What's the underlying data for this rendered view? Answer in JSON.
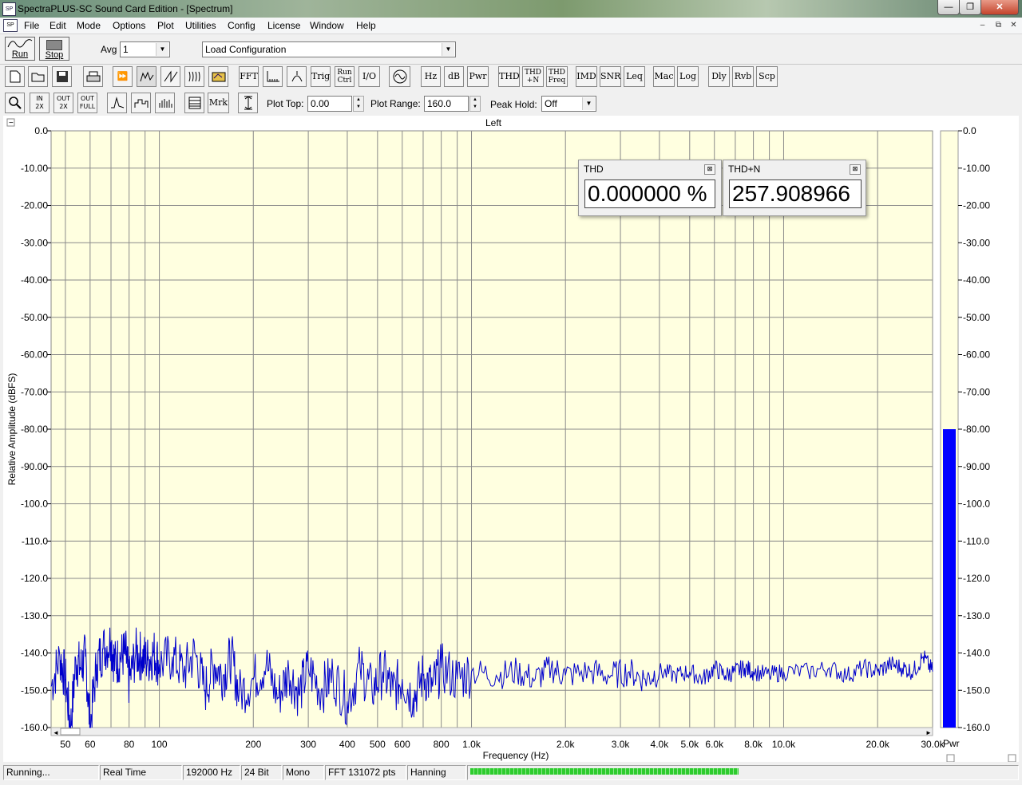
{
  "window": {
    "title": "SpectraPLUS-SC Sound Card Edition - [Spectrum]",
    "minimize": "—",
    "maximize": "❐",
    "close": "✕"
  },
  "menu": [
    "File",
    "Edit",
    "Mode",
    "Options",
    "Plot",
    "Utilities",
    "Config",
    "License",
    "Window",
    "Help"
  ],
  "mdi_controls": [
    "–",
    "⧉",
    "✕"
  ],
  "run_bar": {
    "run_label": "Run",
    "stop_label": "Stop",
    "avg_label": "Avg",
    "avg_value": "1",
    "config_value": "Load Configuration"
  },
  "toolbar1": {
    "fft": "FFT",
    "trig": "Trig",
    "run_ctrl_1": "Run",
    "run_ctrl_2": "Ctrl",
    "io": "I/O",
    "hz": "Hz",
    "db": "dB",
    "pwr": "Pwr",
    "thd": "THD",
    "thdn_1": "THD",
    "thdn_2": "+N",
    "thdf_1": "THD",
    "thdf_2": "Freq",
    "imd": "IMD",
    "snr": "SNR",
    "leq": "Leq",
    "mac": "Mac",
    "log": "Log",
    "dly": "Dly",
    "rvb": "Rvb",
    "scp": "Scp"
  },
  "toolbar2": {
    "zoom_in_1": "IN",
    "zoom_in_2": "2X",
    "zoom_out_1": "OUT",
    "zoom_out_2": "2X",
    "zoom_full_1": "OUT",
    "zoom_full_2": "FULL",
    "mrk": "Mrk",
    "plot_top_label": "Plot Top:",
    "plot_top_value": "0.00",
    "plot_range_label": "Plot Range:",
    "plot_range_value": "160.0",
    "peak_hold_label": "Peak Hold:",
    "peak_hold_value": "Off"
  },
  "chart_data": {
    "type": "line",
    "title": "Left",
    "xlabel": "Frequency (Hz)",
    "ylabel": "Relative Amplitude (dBFS)",
    "x_scale": "log",
    "xlim": [
      45,
      30000
    ],
    "ylim": [
      -160,
      0
    ],
    "x_ticks": [
      {
        "v": 50,
        "l": "50"
      },
      {
        "v": 60,
        "l": "60"
      },
      {
        "v": 80,
        "l": "80"
      },
      {
        "v": 100,
        "l": "100"
      },
      {
        "v": 200,
        "l": "200"
      },
      {
        "v": 300,
        "l": "300"
      },
      {
        "v": 400,
        "l": "400"
      },
      {
        "v": 500,
        "l": "500"
      },
      {
        "v": 600,
        "l": "600"
      },
      {
        "v": 800,
        "l": "800"
      },
      {
        "v": 1000,
        "l": "1.0k"
      },
      {
        "v": 2000,
        "l": "2.0k"
      },
      {
        "v": 3000,
        "l": "3.0k"
      },
      {
        "v": 4000,
        "l": "4.0k"
      },
      {
        "v": 5000,
        "l": "5.0k"
      },
      {
        "v": 6000,
        "l": "6.0k"
      },
      {
        "v": 8000,
        "l": "8.0k"
      },
      {
        "v": 10000,
        "l": "10.0k"
      },
      {
        "v": 20000,
        "l": "20.0k"
      },
      {
        "v": 30000,
        "l": "30.0k"
      }
    ],
    "y_ticks": [
      "0.0",
      "-10.00",
      "-20.00",
      "-30.00",
      "-40.00",
      "-50.00",
      "-60.00",
      "-70.00",
      "-80.00",
      "-90.00",
      "-100.0",
      "-110.0",
      "-120.0",
      "-130.0",
      "-140.0",
      "-150.0",
      "-160.0"
    ],
    "y_ticks_right": [
      "0.0",
      "-10.00",
      "-20.00",
      "-30.00",
      "-40.00",
      "-50.00",
      "-60.00",
      "-70.00",
      "-80.00",
      "-90.00",
      "-100.0",
      "-110.0",
      "-120.0",
      "-130.0",
      "-140.0",
      "-150.0",
      "-160.0"
    ],
    "grid": true,
    "background": "#ffffe0",
    "series": [
      {
        "color": "#0000cc",
        "x": [
          45,
          48,
          50,
          52,
          54,
          56,
          58,
          60,
          63,
          66,
          70,
          72,
          75,
          78,
          80,
          84,
          88,
          92,
          96,
          100,
          110,
          120,
          130,
          140,
          150,
          160,
          170,
          180,
          200,
          220,
          240,
          260,
          280,
          300,
          330,
          360,
          400,
          440,
          480,
          520,
          560,
          600,
          650,
          700,
          750,
          800,
          900,
          1000,
          1200,
          1400,
          1600,
          1800,
          2000,
          2400,
          2800,
          3200,
          3600,
          4000,
          4500,
          5000,
          5500,
          6000,
          6500,
          7000,
          7500,
          8000,
          9000,
          10000,
          12000,
          14000,
          16000,
          18000,
          20000,
          22000,
          24000,
          26000,
          28000,
          30000
        ],
        "y": [
          -149,
          -141,
          -147,
          -160,
          -142,
          -144,
          -141,
          -160,
          -143,
          -139,
          -137,
          -143,
          -141,
          -140,
          -148,
          -140,
          -141,
          -142,
          -140,
          -143,
          -141,
          -145,
          -140,
          -150,
          -143,
          -146,
          -141,
          -151,
          -147,
          -143,
          -152,
          -145,
          -151,
          -144,
          -150,
          -146,
          -153,
          -144,
          -150,
          -145,
          -150,
          -147,
          -152,
          -146,
          -149,
          -144,
          -147,
          -145,
          -146,
          -145,
          -147,
          -144,
          -146,
          -145,
          -146,
          -145,
          -147,
          -145,
          -146,
          -145,
          -147,
          -144,
          -146,
          -145,
          -144,
          -145,
          -146,
          -145,
          -145,
          -144,
          -146,
          -144,
          -145,
          -143,
          -144,
          -145,
          -141,
          -145
        ]
      }
    ],
    "meter": {
      "label": "Pwr",
      "value": -80,
      "color": "#0000ff"
    }
  },
  "meters": {
    "thd_title": "THD",
    "thd_value": "0.000000 %",
    "thdn_title": "THD+N",
    "thdn_value": "257.908966"
  },
  "status": {
    "state": "Running...",
    "mode": "Real Time",
    "rate": "192000 Hz",
    "bits": "24 Bit",
    "channels": "Mono",
    "fft": "FFT 131072 pts",
    "window": "Hanning"
  }
}
